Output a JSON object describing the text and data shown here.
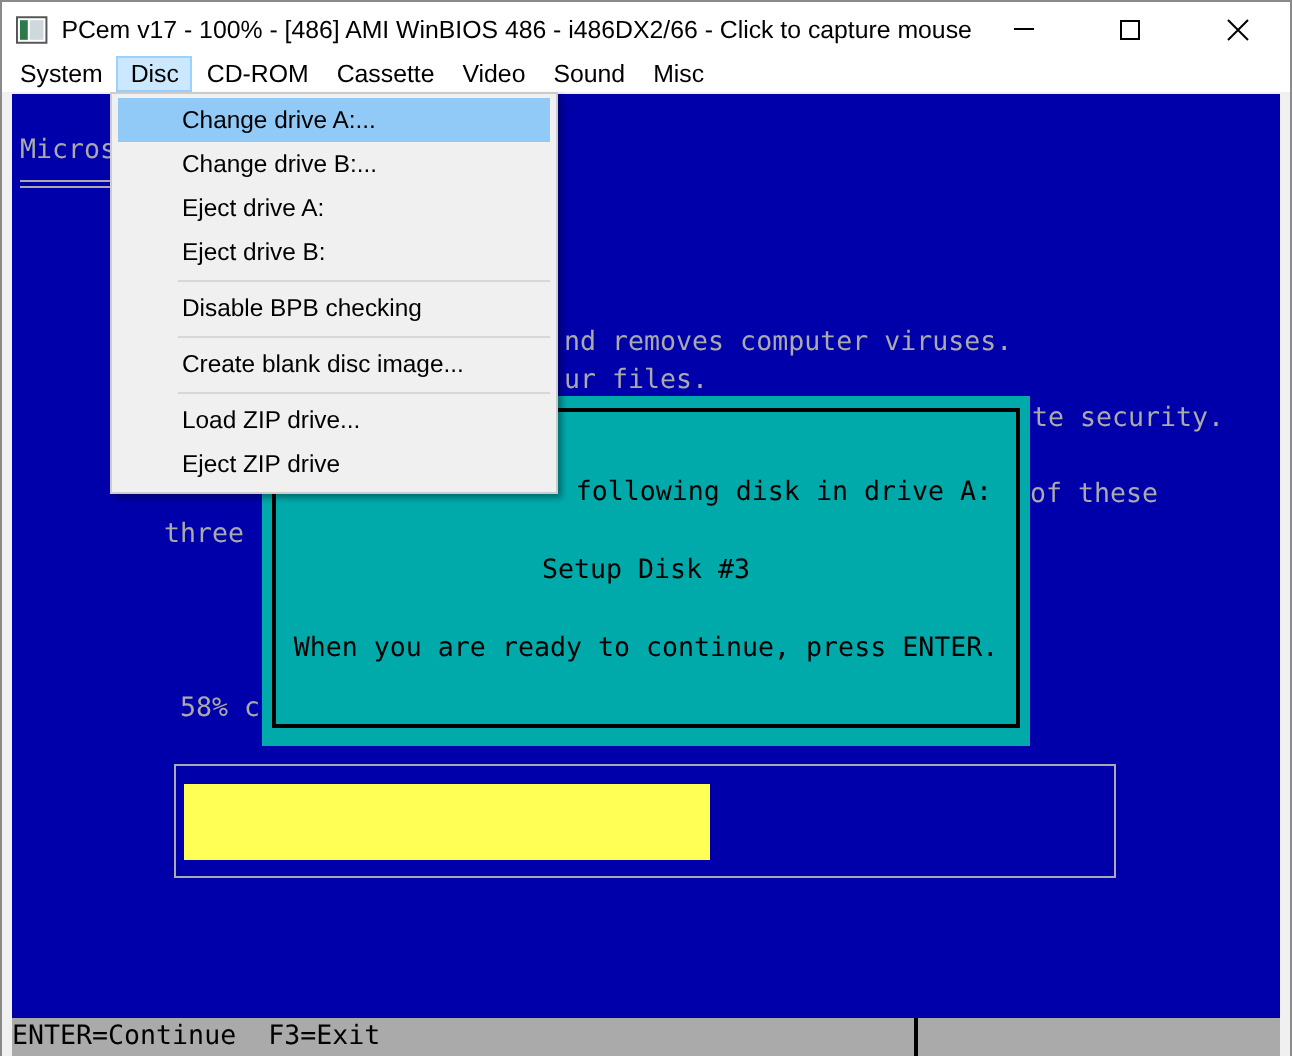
{
  "window": {
    "title": "PCem v17 - 100% - [486] AMI WinBIOS 486 - i486DX2/66 - Click to capture mouse"
  },
  "menu_bar": [
    {
      "label": "System",
      "selected": false
    },
    {
      "label": "Disc",
      "selected": true
    },
    {
      "label": "CD-ROM",
      "selected": false
    },
    {
      "label": "Cassette",
      "selected": false
    },
    {
      "label": "Video",
      "selected": false
    },
    {
      "label": "Sound",
      "selected": false
    },
    {
      "label": "Misc",
      "selected": false
    }
  ],
  "dropdown": [
    {
      "kind": "item",
      "label": "Change drive A:...",
      "selected": true
    },
    {
      "kind": "item",
      "label": "Change drive B:...",
      "selected": false
    },
    {
      "kind": "item",
      "label": "Eject drive A:",
      "selected": false
    },
    {
      "kind": "item",
      "label": "Eject drive B:",
      "selected": false
    },
    {
      "kind": "separator"
    },
    {
      "kind": "item",
      "label": "Disable BPB checking",
      "selected": false
    },
    {
      "kind": "separator"
    },
    {
      "kind": "item",
      "label": "Create blank disc image...",
      "selected": false
    },
    {
      "kind": "separator"
    },
    {
      "kind": "item",
      "label": "Load ZIP drive...",
      "selected": false
    },
    {
      "kind": "item",
      "label": "Eject ZIP drive",
      "selected": false
    }
  ],
  "dos_screen": {
    "background_text": [
      "Micros",
      "nd removes computer viruses.",
      "ur files.",
      "te security.",
      "of these",
      "three",
      "58% c"
    ],
    "dialog": [
      "following disk in drive A:",
      "Setup Disk #3",
      "When you are ready to continue, press ENTER."
    ],
    "progress": {
      "level": 0.57
    },
    "status_bar": [
      "ENTER=Continue",
      "F3=Exit"
    ]
  }
}
